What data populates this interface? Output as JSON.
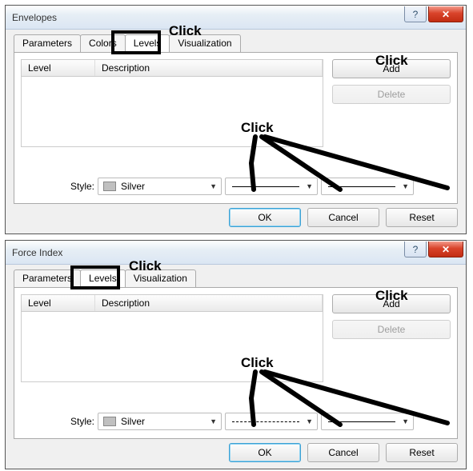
{
  "annotations": {
    "click": "Click"
  },
  "dialog1": {
    "title": "Envelopes",
    "tabs": {
      "parameters": "Parameters",
      "colors": "Colors",
      "levels": "Levels",
      "visualization": "Visualization"
    },
    "columns": {
      "level": "Level",
      "description": "Description"
    },
    "buttons": {
      "add": "Add",
      "delete": "Delete",
      "ok": "OK",
      "cancel": "Cancel",
      "reset": "Reset"
    },
    "style": {
      "label": "Style:",
      "color_name": "Silver",
      "color_hex": "#c0c0c0",
      "line_style": "solid",
      "line_width": "1"
    }
  },
  "dialog2": {
    "title": "Force Index",
    "tabs": {
      "parameters": "Parameters",
      "levels": "Levels",
      "visualization": "Visualization"
    },
    "columns": {
      "level": "Level",
      "description": "Description"
    },
    "buttons": {
      "add": "Add",
      "delete": "Delete",
      "ok": "OK",
      "cancel": "Cancel",
      "reset": "Reset"
    },
    "style": {
      "label": "Style:",
      "color_name": "Silver",
      "color_hex": "#c0c0c0",
      "line_style": "dashed",
      "line_width": "1"
    }
  }
}
